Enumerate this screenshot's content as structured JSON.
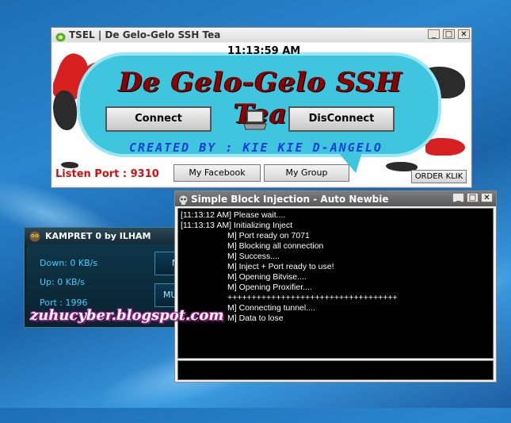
{
  "ssh_window": {
    "title": "TSEL | De Gelo-Gelo SSH Tea",
    "clock": "11:13:59 AM",
    "banner_title": "De Gelo-Gelo SSH Tea",
    "connect_label": "Connect",
    "disconnect_label": "DisConnect",
    "created_by": "CREATED BY : KIE KIE D-ANGELO",
    "listen_port": "Listen Port : 9310",
    "facebook_label": "My Facebook",
    "group_label": "My Group",
    "order_label": "ORDER KLIK",
    "minimize": "_",
    "maximize": "□",
    "close": "✕"
  },
  "kampret_window": {
    "title": "KAMPRET 0 by ILHAM",
    "down": "Down: 0 KB/s",
    "up": "Up: 0 KB/s",
    "port": "Port : 1996",
    "maju_label": "MAJU",
    "mundur_label": "MUNDUR",
    "minimize": "—",
    "close": "✕"
  },
  "watermark": "zuhucyber.blogspot.com",
  "injection_window": {
    "title": "Simple Block Injection - Auto Newbie",
    "minimize": "_",
    "maximize": "□",
    "close": "✕",
    "log": [
      "[11:13:12 AM] Please wait....",
      "[11:13:13 AM] Initializing Inject",
      "M] Port ready on 7071",
      "M] Blocking all connection",
      "M] Success....",
      "M] Inject + Port ready to use!",
      "M] Opening Bitvise....",
      "M] Opening Proxifier....",
      "+++++++++++++++++++++++++++++++++++",
      "M] Connecting tunnel....",
      "M] Data to lose"
    ]
  },
  "colors": {
    "desktop": "#1e6fb4",
    "bubble": "#3fc5de",
    "banner_text": "#8b0000",
    "listen_port": "#d01010",
    "created_by": "#1a3fd6",
    "kampret_text": "#3dd0ff"
  }
}
